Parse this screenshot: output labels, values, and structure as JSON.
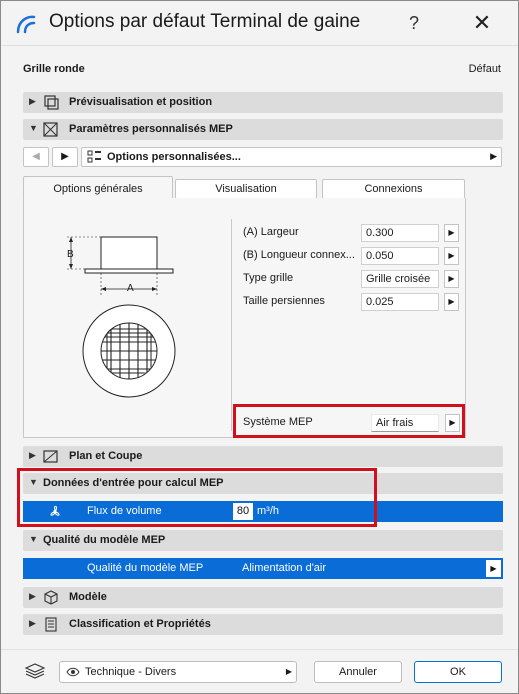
{
  "window": {
    "title": "Options par défaut Terminal de gaine",
    "help": "?",
    "close": "✕"
  },
  "header": {
    "object_name": "Grille ronde",
    "default_label": "Défaut"
  },
  "sections": {
    "preview": "Prévisualisation et position",
    "mep_params": "Paramètres personnalisés MEP",
    "plan": "Plan et Coupe",
    "mep_calc": "Données d'entrée pour calcul MEP",
    "model_quality": "Qualité du modèle MEP",
    "model": "Modèle",
    "classification": "Classification et Propriétés"
  },
  "nav": {
    "dropdown": "Options personnalisées..."
  },
  "tabs": [
    "Options générales",
    "Visualisation",
    "Connexions"
  ],
  "diagram": {
    "label_a": "A",
    "label_b": "B"
  },
  "fields": [
    {
      "label": "(A) Largeur",
      "value": "0.300"
    },
    {
      "label": "(B) Longueur connex...",
      "value": "0.050"
    },
    {
      "label": "Type grille",
      "value": "Grille croisée"
    },
    {
      "label": "Taille persiennes",
      "value": "0.025"
    }
  ],
  "system": {
    "label": "Système MEP",
    "value": "Air frais"
  },
  "flow": {
    "label": "Flux de volume",
    "value": "80",
    "unit": "m³/h"
  },
  "quality": {
    "label": "Qualité du modèle MEP",
    "value": "Alimentation d'air"
  },
  "footer": {
    "favorite": "Technique - Divers",
    "cancel": "Annuler",
    "ok": "OK"
  },
  "colors": {
    "selection": "#0a6cd6",
    "highlight": "#d0101c",
    "accent": "#1e6fd9"
  }
}
